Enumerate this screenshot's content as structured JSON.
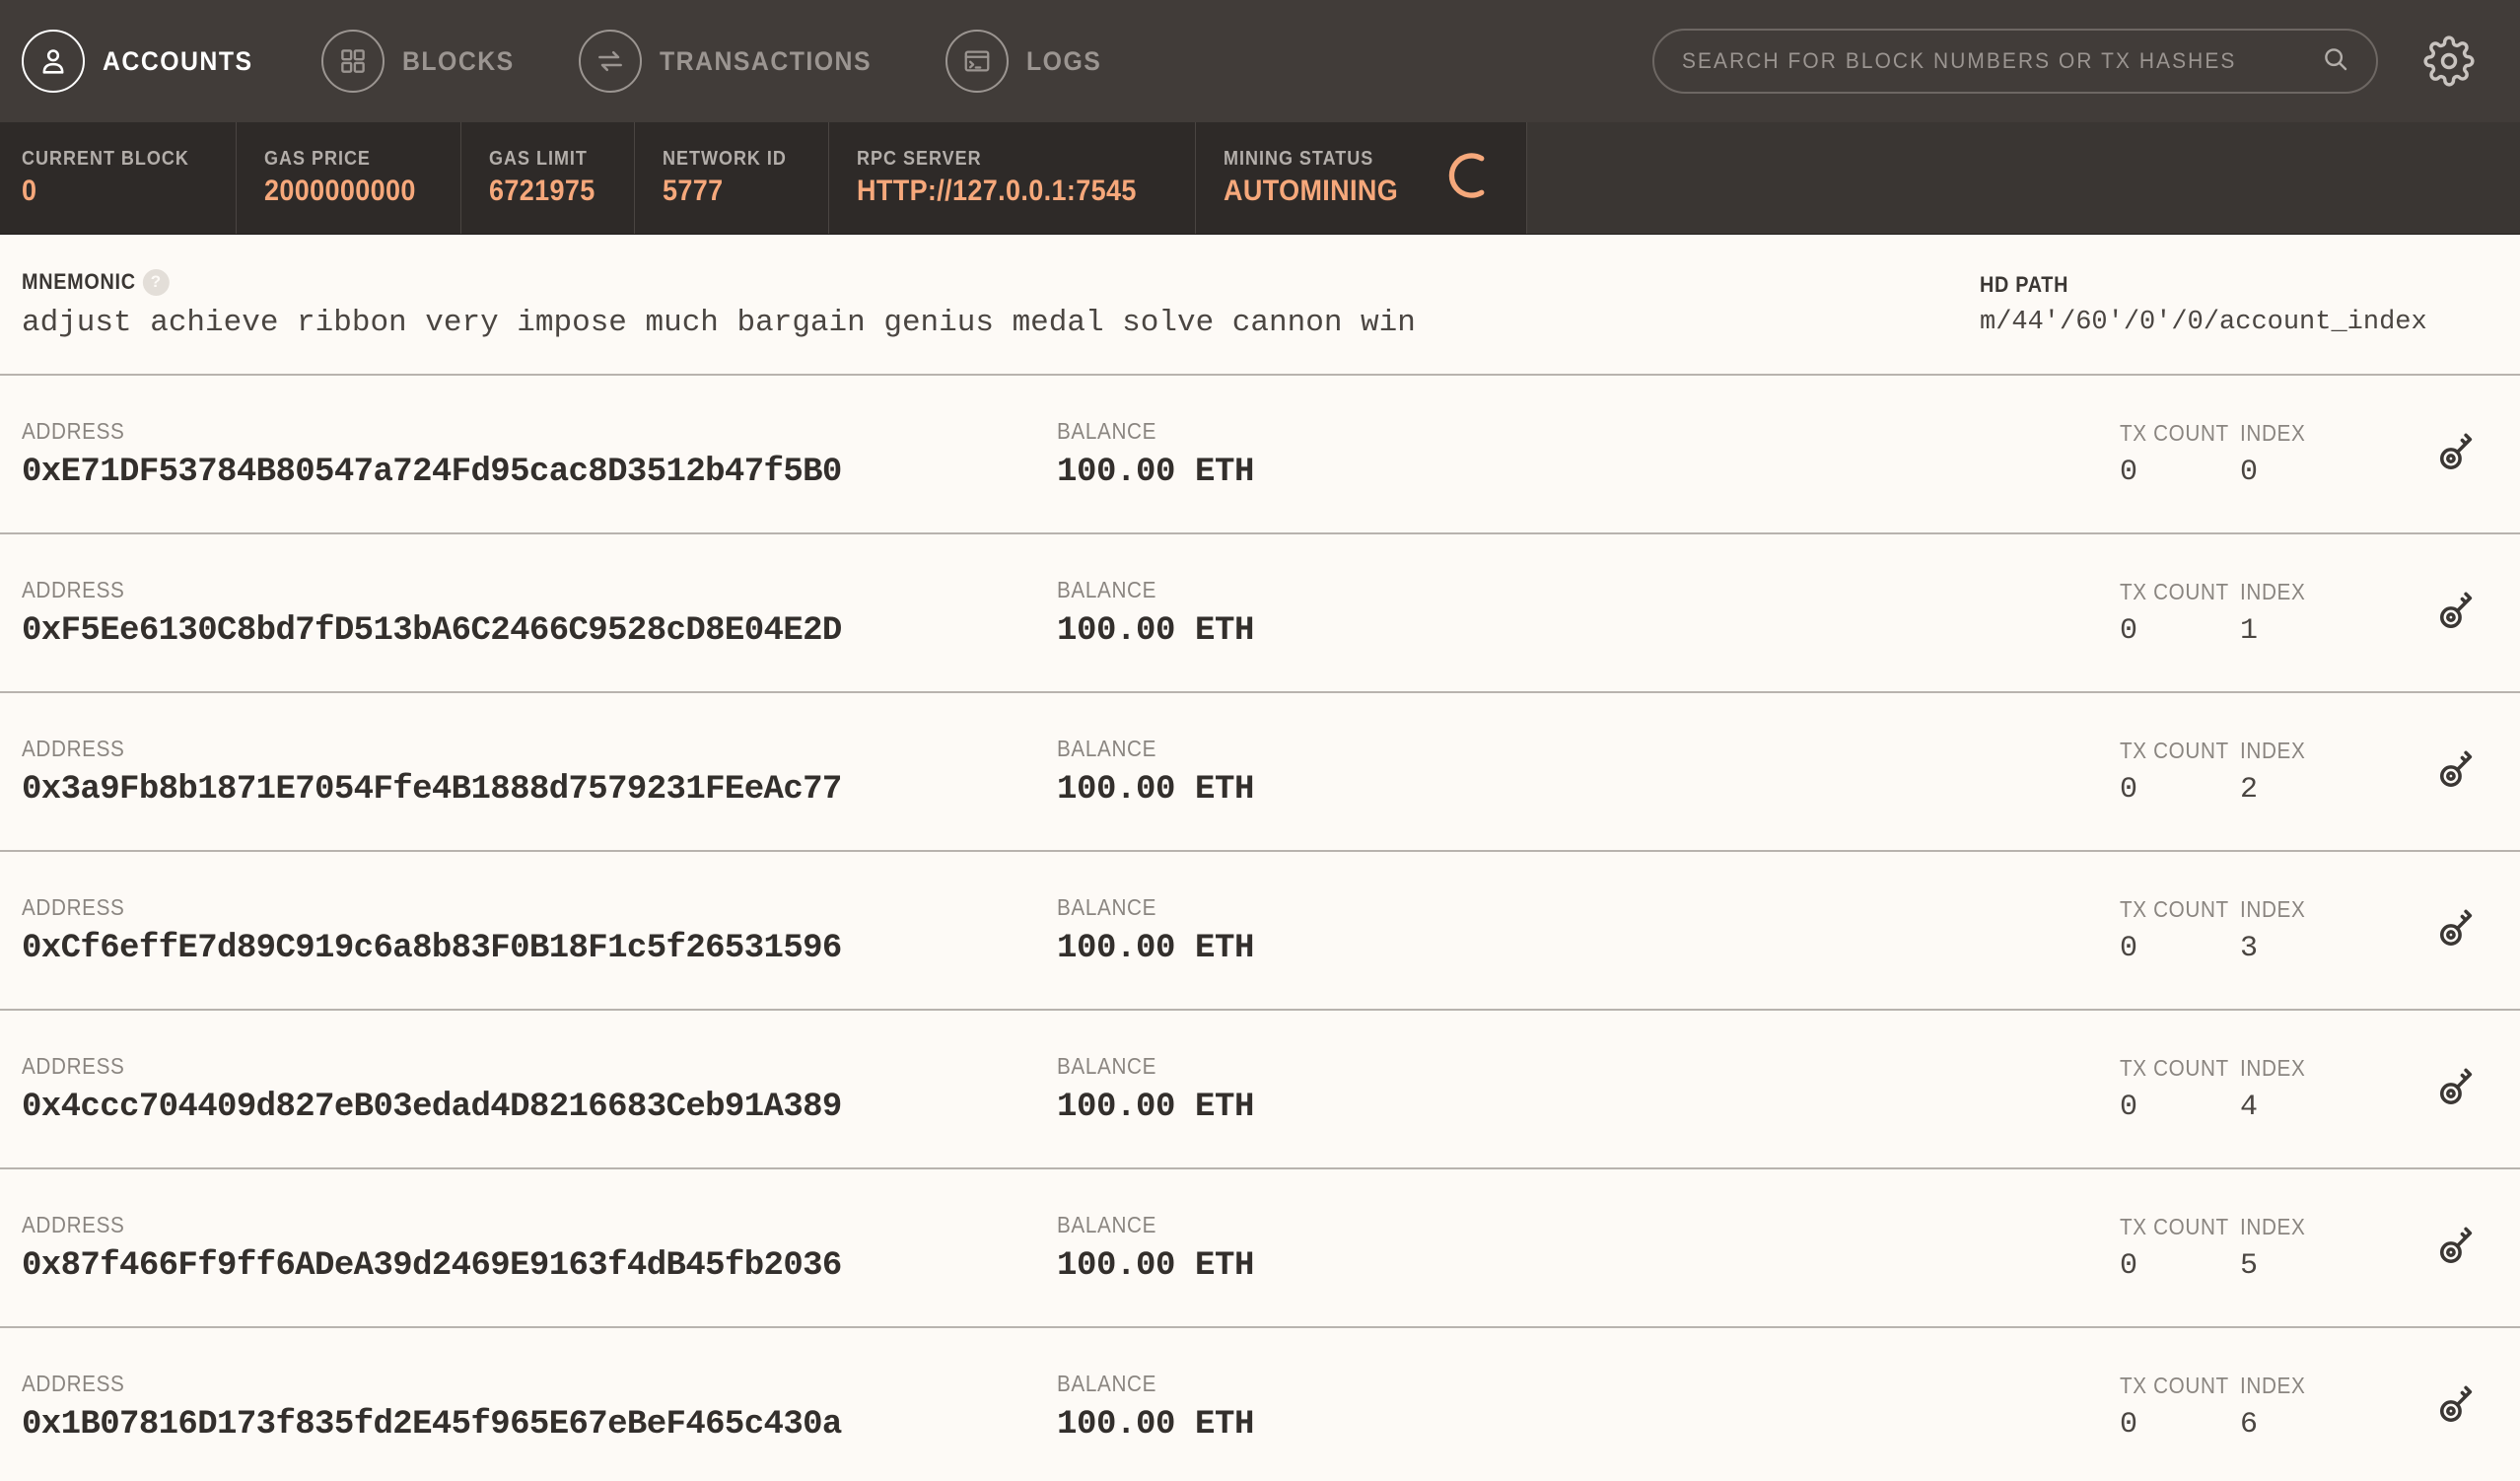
{
  "colors": {
    "nav_bg": "#413c39",
    "status_bg": "#2e2a28",
    "accent": "#f6a87b",
    "page_bg": "#fdfaf6",
    "text_dark": "#332f2c",
    "text_muted": "#8a8580"
  },
  "nav": {
    "tabs": [
      {
        "label": "ACCOUNTS",
        "icon": "account-icon",
        "active": true
      },
      {
        "label": "BLOCKS",
        "icon": "blocks-icon",
        "active": false
      },
      {
        "label": "TRANSACTIONS",
        "icon": "transactions-icon",
        "active": false
      },
      {
        "label": "LOGS",
        "icon": "logs-icon",
        "active": false
      }
    ],
    "search": {
      "placeholder": "SEARCH FOR BLOCK NUMBERS OR TX HASHES",
      "value": "",
      "icon": "search-icon"
    },
    "settings_icon": "gear-icon"
  },
  "status": {
    "items": [
      {
        "key": "CURRENT BLOCK",
        "value": "0"
      },
      {
        "key": "GAS PRICE",
        "value": "2000000000"
      },
      {
        "key": "GAS LIMIT",
        "value": "6721975"
      },
      {
        "key": "NETWORK ID",
        "value": "5777"
      },
      {
        "key": "RPC SERVER",
        "value": "HTTP://127.0.0.1:7545"
      }
    ],
    "mining": {
      "key": "MINING STATUS",
      "value": "AUTOMINING",
      "icon": "spinner-icon"
    }
  },
  "mnemonic": {
    "label": "MNEMONIC",
    "help": "?",
    "words": "adjust achieve ribbon very impose much bargain genius medal solve cannon win",
    "hd_path_label": "HD PATH",
    "hd_path_value": "m/44'/60'/0'/0/account_index"
  },
  "table": {
    "labels": {
      "address": "ADDRESS",
      "balance": "BALANCE",
      "tx_count": "TX COUNT",
      "index": "INDEX"
    },
    "key_icon": "key-icon",
    "rows": [
      {
        "address": "0xE71DF53784B80547a724Fd95cac8D3512b47f5B0",
        "balance": "100.00 ETH",
        "tx_count": "0",
        "index": "0"
      },
      {
        "address": "0xF5Ee6130C8bd7fD513bA6C2466C9528cD8E04E2D",
        "balance": "100.00 ETH",
        "tx_count": "0",
        "index": "1"
      },
      {
        "address": "0x3a9Fb8b1871E7054Ffe4B1888d7579231FEeAc77",
        "balance": "100.00 ETH",
        "tx_count": "0",
        "index": "2"
      },
      {
        "address": "0xCf6effE7d89C919c6a8b83F0B18F1c5f26531596",
        "balance": "100.00 ETH",
        "tx_count": "0",
        "index": "3"
      },
      {
        "address": "0x4ccc704409d827eB03edad4D8216683Ceb91A389",
        "balance": "100.00 ETH",
        "tx_count": "0",
        "index": "4"
      },
      {
        "address": "0x87f466Ff9ff6ADeA39d2469E9163f4dB45fb2036",
        "balance": "100.00 ETH",
        "tx_count": "0",
        "index": "5"
      },
      {
        "address": "0x1B07816D173f835fd2E45f965E67eBeF465c430a",
        "balance": "100.00 ETH",
        "tx_count": "0",
        "index": "6"
      }
    ]
  }
}
